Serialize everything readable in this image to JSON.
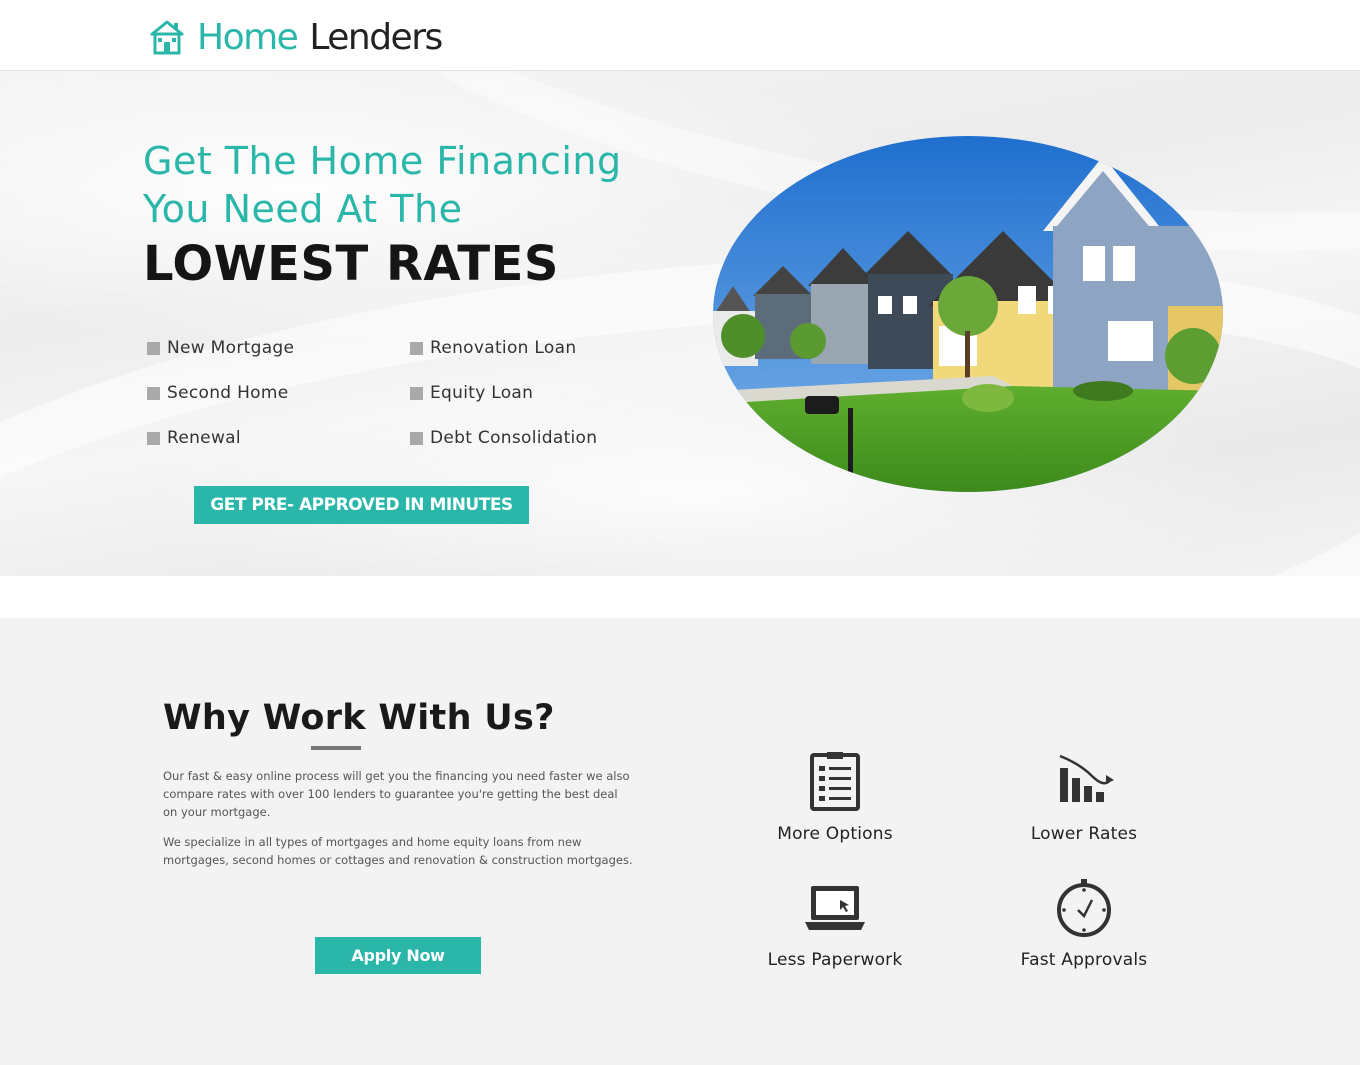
{
  "header": {
    "logo_word1": "Home",
    "logo_word2": "Lenders"
  },
  "hero": {
    "title_line1": "Get The Home Financing",
    "title_line2": "You Need At The",
    "title_emphasis": "LOWEST RATES",
    "features": [
      "New Mortgage",
      "Renovation Loan",
      "Second Home",
      "Equity Loan",
      "Renewal",
      "Debt Consolidation"
    ],
    "cta_label": "GET PRE- APPROVED IN MINUTES"
  },
  "why": {
    "title": "Why Work With Us?",
    "paragraph1": "Our fast & easy online process will get you the financing you need faster we also compare rates with over 100 lenders to guarantee you're getting the best deal on your mortgage.",
    "paragraph2": "We specialize in all types of mortgages and home equity loans from new mortgages, second homes or cottages and renovation & construction mortgages.",
    "apply_label": "Apply Now",
    "benefits": [
      {
        "label": "More Options",
        "icon": "clipboard-list-icon"
      },
      {
        "label": "Lower Rates",
        "icon": "bar-chart-down-icon"
      },
      {
        "label": "Less Paperwork",
        "icon": "laptop-icon"
      },
      {
        "label": "Fast Approvals",
        "icon": "clock-icon"
      }
    ]
  },
  "colors": {
    "brand": "#2ab7aa",
    "dark": "#151515",
    "icon": "#333333"
  }
}
